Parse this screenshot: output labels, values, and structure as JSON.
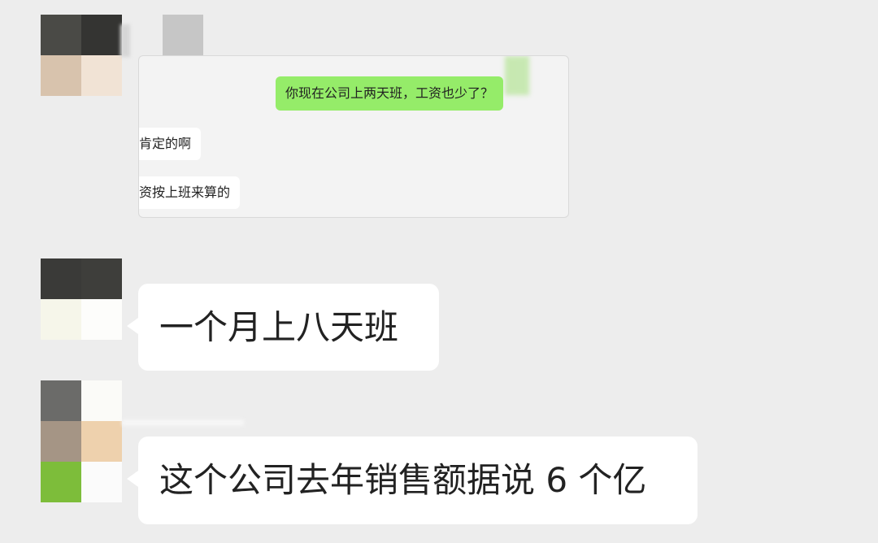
{
  "embedded_screenshot": {
    "outgoing_message": "你现在公司上两天班，工资也少了？",
    "incoming_messages": [
      "肯定的啊",
      "资按上班来算的"
    ]
  },
  "chat": {
    "messages": [
      {
        "text": "一个月上八天班"
      },
      {
        "text": "这个公司去年销售额据说 6 个亿"
      }
    ]
  },
  "colors": {
    "background": "#ededed",
    "sent_bubble": "#95ec69",
    "received_bubble": "#ffffff",
    "text": "#222222"
  }
}
